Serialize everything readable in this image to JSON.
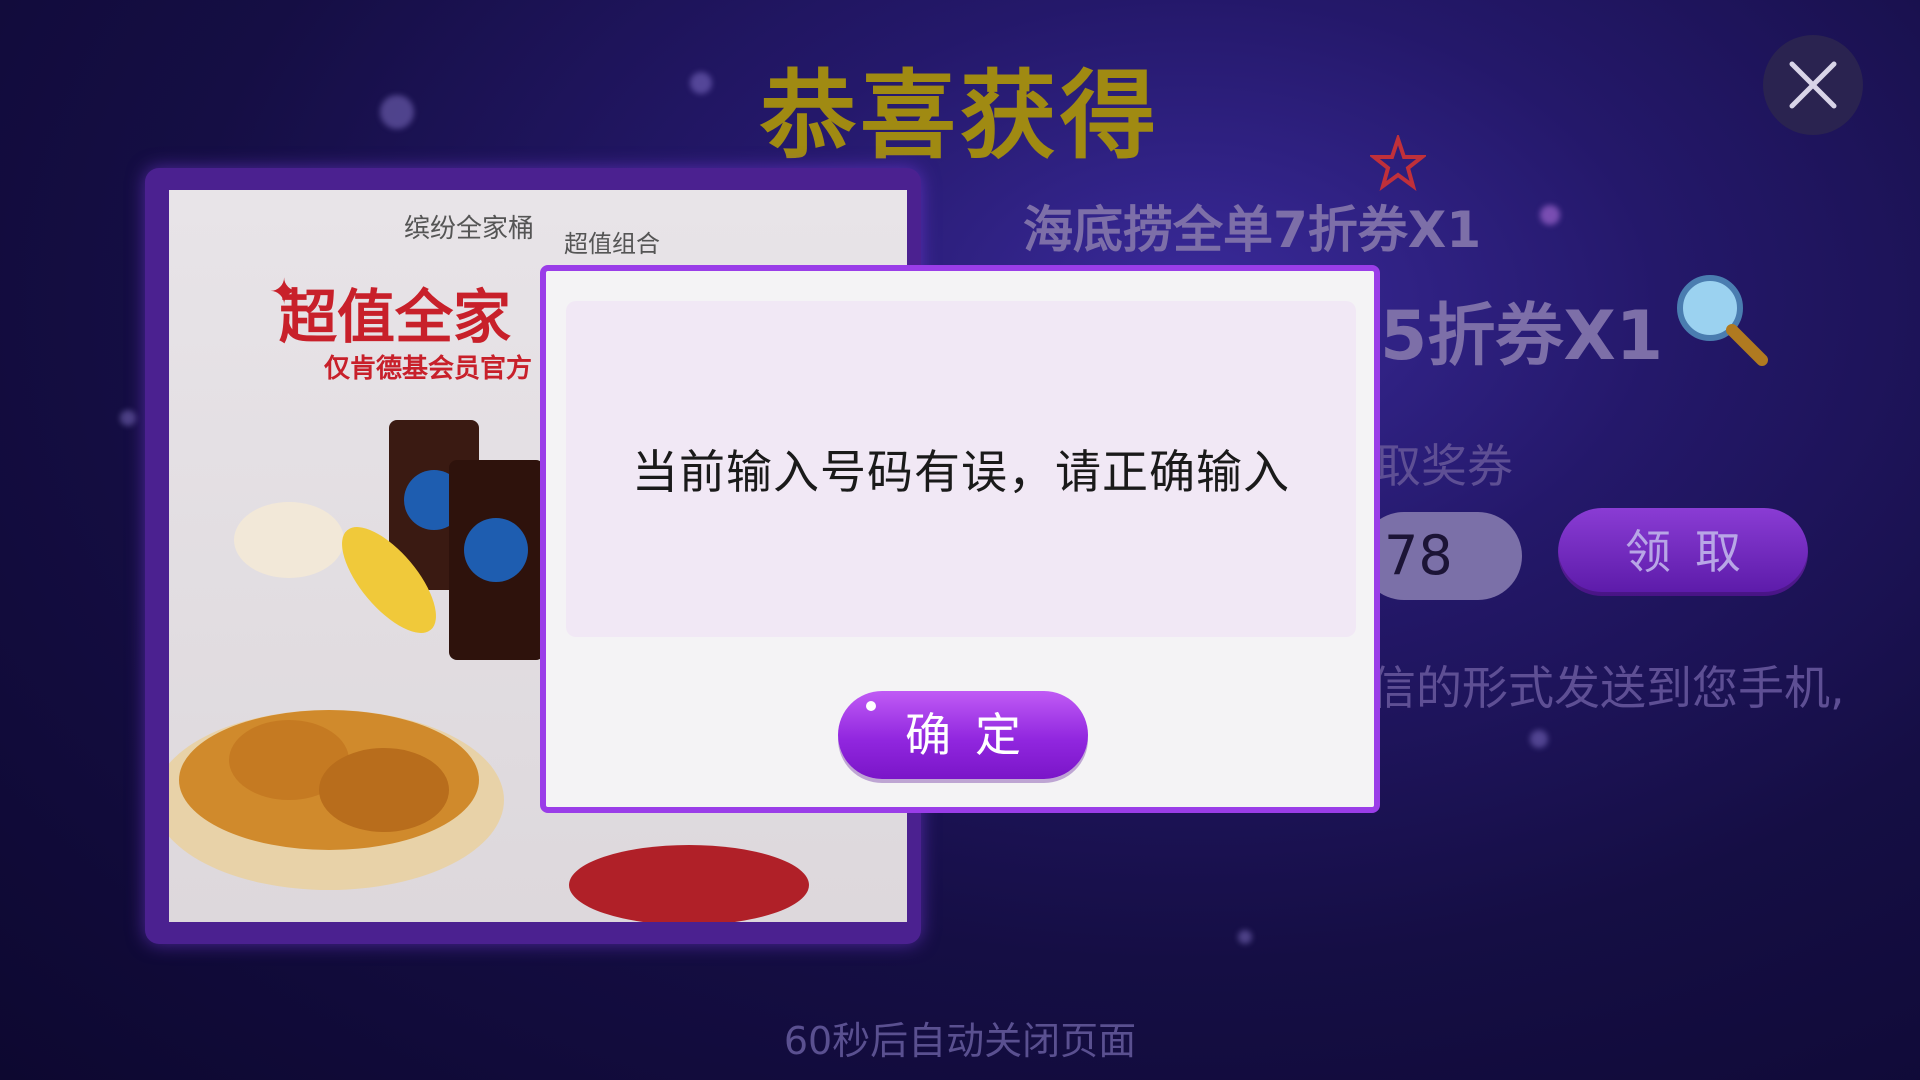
{
  "header": {
    "title": "恭喜获得"
  },
  "prize_image": {
    "sub1": "缤纷全家桶",
    "sub2": "超值组合",
    "headline": "超值全家",
    "note": "仅肯德基会员官方"
  },
  "info": {
    "line1": "海底捞全单7折券X1",
    "line2": "5折券X1",
    "line3": "取奖券",
    "line4": "信的形式发送到您手机,"
  },
  "redeem": {
    "input_value": "78",
    "claim_label": "领取"
  },
  "footer": {
    "text": "60秒后自动关闭页面"
  },
  "dialog": {
    "message": "当前输入号码有误，请正确输入",
    "confirm_label": "确定"
  },
  "icons": [
    "close-icon",
    "magnifier-icon",
    "star-icon"
  ],
  "colors": {
    "accent": "#9a3de8",
    "title": "#a08a12",
    "background": "#150e44"
  }
}
